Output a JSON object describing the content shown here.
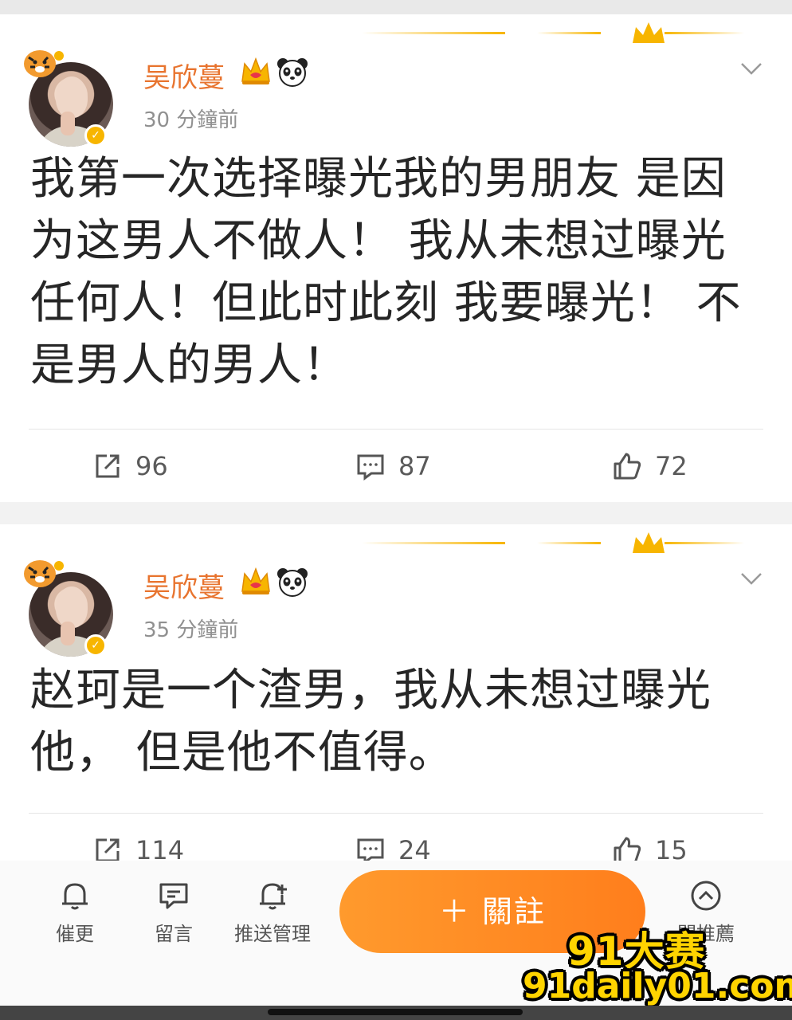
{
  "posts": [
    {
      "author": "吴欣蔓",
      "time": "30 分鐘前",
      "text": "我第一次选择曝光我的男朋友 是因为这男人不做人！ 我从未想过曝光任何人！但此时此刻 我要曝光！ 不是男人的男人！",
      "reposts": "96",
      "comments": "87",
      "likes": "72"
    },
    {
      "author": "吴欣蔓",
      "time": "35 分鐘前",
      "text": "赵珂是一个渣男，我从未想过曝光他， 但是他不值得。",
      "reposts": "114",
      "comments": "24",
      "likes": "15"
    }
  ],
  "icons": {
    "crown_badge": "crown-icon",
    "panda_badge": "panda-icon",
    "verified": "verified-badge-icon",
    "more": "chevron-down-icon",
    "repost": "repost-icon",
    "comment": "comment-icon",
    "like": "thumbs-up-icon",
    "remind": "bell-icon",
    "message": "message-icon",
    "push": "bell-plus-icon",
    "recommend": "chevron-up-circle-icon"
  },
  "tabbar": {
    "remind": "催更",
    "message": "留言",
    "push": "推送管理",
    "follow": "＋ 關註",
    "recommend": "關推薦"
  },
  "watermark": {
    "line1": "91大赛",
    "line2": "91daily01.com"
  },
  "colors": {
    "name": "#e8742f",
    "accent": "#ff8a24",
    "gold": "#f7b500",
    "watermark": "#ffd400"
  }
}
